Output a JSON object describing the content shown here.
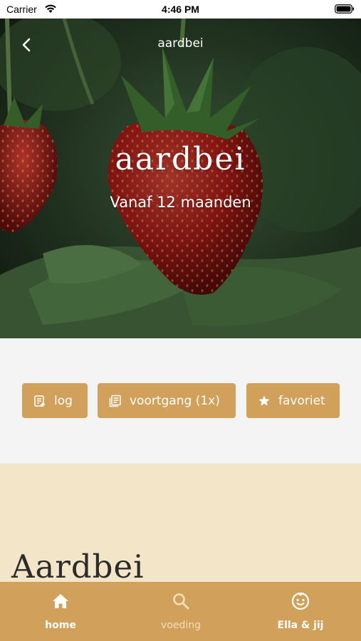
{
  "status_bar": {
    "carrier": "Carrier",
    "time": "4:46 PM"
  },
  "hero": {
    "nav_title": "aardbei",
    "title": "aardbei",
    "subtitle": "Vanaf 12 maanden"
  },
  "actions": {
    "log_label": "log",
    "progress_label": "voortgang (1x)",
    "favorite_label": "favoriet"
  },
  "content": {
    "heading": "Aardbei"
  },
  "tab_bar": {
    "home_label": "home",
    "voeding_label": "voeding",
    "ella_label": "Ella & jij"
  },
  "colors": {
    "accent": "#d1a05a",
    "content_background": "#f3e5c8",
    "action_background": "#f4f4f4"
  }
}
